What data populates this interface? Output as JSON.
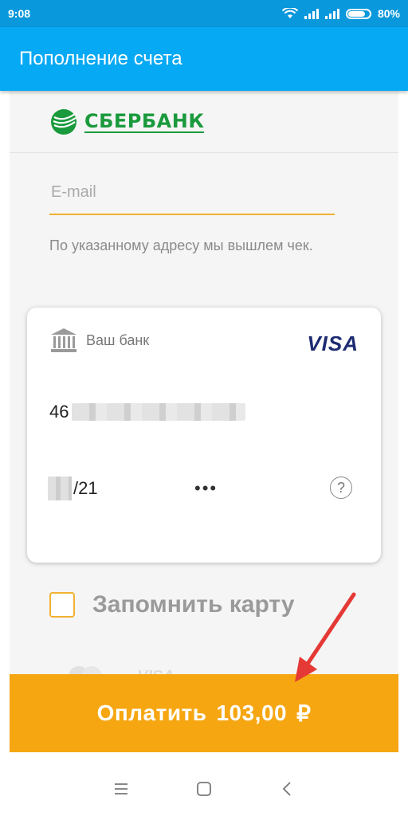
{
  "status_bar": {
    "time": "9:08",
    "battery": "80%"
  },
  "app_bar": {
    "title": "Пополнение счета"
  },
  "bank": {
    "name": "СБЕРБАНК",
    "brand_color": "#1a9a3c"
  },
  "email": {
    "placeholder": "E-mail",
    "value": ""
  },
  "hint_text": "По указанному адресу мы вышлем чек.",
  "card": {
    "bank_label": "Ваш банк",
    "network": "VISA",
    "number_prefix": "46",
    "expiry_suffix": "/21",
    "cvc": "•••",
    "help": "?"
  },
  "remember": {
    "label": "Запомнить карту",
    "checked": false
  },
  "pay_logos": [
    "VISA"
  ],
  "pay_button": {
    "label": "Оплатить",
    "amount": "103,00",
    "currency": "₽",
    "color": "#f6a611"
  },
  "colors": {
    "status_bar": "#0a98dc",
    "app_bar": "#06a9f4",
    "accent": "#f2b132",
    "arrow": "#e53935"
  },
  "nav": [
    "menu-icon",
    "home-icon",
    "back-icon"
  ]
}
